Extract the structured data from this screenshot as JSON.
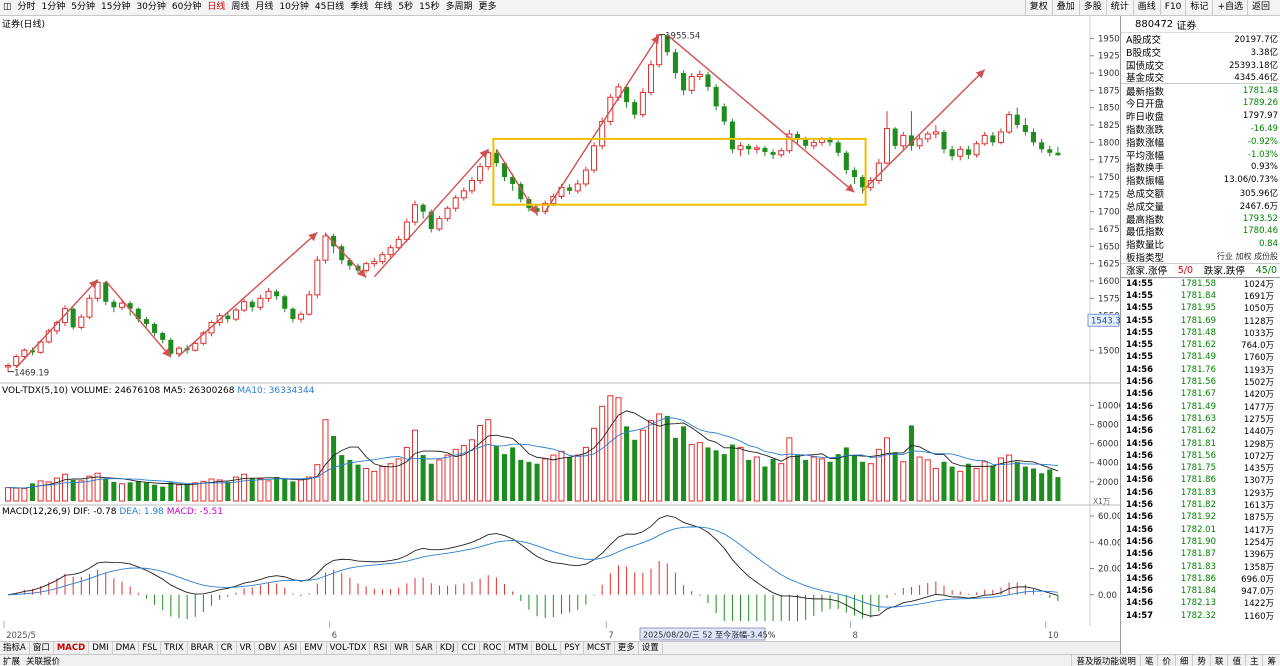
{
  "toolbar": {
    "periods": [
      "分时",
      "1分钟",
      "5分钟",
      "15分钟",
      "30分钟",
      "60分钟",
      "日线",
      "周线",
      "月线",
      "10分钟",
      "45日线",
      "季线",
      "年线",
      "5秒",
      "15秒",
      "多周期",
      "更多"
    ],
    "active_period": "日线",
    "right_tools": [
      "复权",
      "叠加",
      "多股",
      "统计",
      "画线",
      "F10",
      "标记",
      "+自选",
      "返回"
    ]
  },
  "price_pane": {
    "title": "证券(日线)",
    "y_ticks": [
      "1950",
      "1925",
      "1900",
      "1875",
      "1850",
      "1825",
      "1800",
      "1775",
      "1750",
      "1725",
      "1700",
      "1675",
      "1650",
      "1625",
      "1600",
      "1575",
      "1550",
      "1500"
    ],
    "high_label": "1955.54",
    "low_label": "1469.19",
    "current_marker": "1543.3"
  },
  "volume_pane": {
    "label": "VOL-TDX(5,10)",
    "volume": "VOLUME: 24676108",
    "ma5": "MA5: 26300268",
    "ma10": "MA10: 36334344",
    "y_ticks": [
      "10000",
      "8000",
      "6000",
      "4000",
      "2000"
    ],
    "unit": "X1万"
  },
  "macd_pane": {
    "label": "MACD(12,26,9)",
    "dif": "DIF: -0.78",
    "dea": "DEA: 1.98",
    "macd": "MACD: -5.51",
    "y_ticks": [
      "60.00",
      "40.00",
      "20.00",
      "0.00"
    ]
  },
  "x_axis": {
    "labels": [
      "2025/5",
      "6",
      "7",
      "8",
      "10"
    ],
    "cursor_date": "2025/08/20/三 52 至今涨幅-3.45%"
  },
  "indicator_tabs": [
    "指标A",
    "窗口",
    "MACD",
    "DMI",
    "DMA",
    "FSL",
    "TRIX",
    "BRAR",
    "CR",
    "VR",
    "OBV",
    "ASI",
    "EMV",
    "VOL-TDX",
    "RSI",
    "WR",
    "SAR",
    "KDJ",
    "CCI",
    "ROC",
    "MTM",
    "BOLL",
    "PSY",
    "MCST",
    "更多",
    "设置"
  ],
  "active_indicator": "MACD",
  "status": {
    "left": [
      "扩展",
      "关联报价"
    ],
    "right_link": "普及版功能说明",
    "right_tabs": [
      "笔",
      "价",
      "细",
      "势",
      "联",
      "值",
      "主",
      "筹"
    ]
  },
  "quote_panel": {
    "code": "880472",
    "name": "证券",
    "turnover": [
      {
        "label": "A股成交",
        "value": "20197.7亿"
      },
      {
        "label": "B股成交",
        "value": "3.38亿"
      },
      {
        "label": "国债成交",
        "value": "25393.18亿"
      },
      {
        "label": "基金成交",
        "value": "4345.46亿"
      }
    ],
    "stats": [
      {
        "label": "最新指数",
        "value": "1781.48",
        "color": "green"
      },
      {
        "label": "今日开盘",
        "value": "1789.26",
        "color": "green"
      },
      {
        "label": "昨日收盘",
        "value": "1797.97",
        "color": "black"
      },
      {
        "label": "指数涨跌",
        "value": "-16.49",
        "color": "green"
      },
      {
        "label": "指数涨幅",
        "value": "-0.92%",
        "color": "green"
      },
      {
        "label": "平均涨幅",
        "value": "-1.03%",
        "color": "green"
      },
      {
        "label": "指数换手",
        "value": "0.93%",
        "color": "black"
      },
      {
        "label": "指数振幅",
        "value": "13.06/0.73%",
        "color": "black"
      },
      {
        "label": "总成交额",
        "value": "305.96亿",
        "color": "black"
      },
      {
        "label": "总成交量",
        "value": "2467.6万",
        "color": "black"
      },
      {
        "label": "最高指数",
        "value": "1793.52",
        "color": "green"
      },
      {
        "label": "最低指数",
        "value": "1780.46",
        "color": "green"
      },
      {
        "label": "指数量比",
        "value": "0.84",
        "color": "green"
      }
    ],
    "board_type_label": "板指类型",
    "board_type_options": "行业 加权 成份股",
    "up_limit_label": "涨家.涨停",
    "up_limit_value": "5/0",
    "down_limit_label": "跌家.跌停",
    "down_limit_value": "45/0",
    "ticks": [
      {
        "time": "14:55",
        "price": "1781.58",
        "vol": "1024万"
      },
      {
        "time": "14:55",
        "price": "1781.84",
        "vol": "1691万"
      },
      {
        "time": "14:55",
        "price": "1781.95",
        "vol": "1050万"
      },
      {
        "time": "14:55",
        "price": "1781.69",
        "vol": "1128万"
      },
      {
        "time": "14:55",
        "price": "1781.48",
        "vol": "1033万"
      },
      {
        "time": "14:55",
        "price": "1781.62",
        "vol": "764.0万"
      },
      {
        "time": "14:55",
        "price": "1781.49",
        "vol": "1760万"
      },
      {
        "time": "14:56",
        "price": "1781.76",
        "vol": "1193万"
      },
      {
        "time": "14:56",
        "price": "1781.56",
        "vol": "1502万"
      },
      {
        "time": "14:56",
        "price": "1781.67",
        "vol": "1420万"
      },
      {
        "time": "14:56",
        "price": "1781.49",
        "vol": "1477万"
      },
      {
        "time": "14:56",
        "price": "1781.63",
        "vol": "1275万"
      },
      {
        "time": "14:56",
        "price": "1781.62",
        "vol": "1440万"
      },
      {
        "time": "14:56",
        "price": "1781.81",
        "vol": "1298万"
      },
      {
        "time": "14:56",
        "price": "1781.56",
        "vol": "1072万"
      },
      {
        "time": "14:56",
        "price": "1781.75",
        "vol": "1435万"
      },
      {
        "time": "14:56",
        "price": "1781.86",
        "vol": "1307万"
      },
      {
        "time": "14:56",
        "price": "1781.83",
        "vol": "1293万"
      },
      {
        "time": "14:56",
        "price": "1781.82",
        "vol": "1613万"
      },
      {
        "time": "14:56",
        "price": "1781.92",
        "vol": "1875万"
      },
      {
        "time": "14:56",
        "price": "1782.01",
        "vol": "1417万"
      },
      {
        "time": "14:56",
        "price": "1781.90",
        "vol": "1254万"
      },
      {
        "time": "14:56",
        "price": "1781.87",
        "vol": "1396万"
      },
      {
        "time": "14:56",
        "price": "1781.83",
        "vol": "1358万"
      },
      {
        "time": "14:56",
        "price": "1781.86",
        "vol": "696.0万"
      },
      {
        "time": "14:56",
        "price": "1781.84",
        "vol": "947.0万"
      },
      {
        "time": "14:56",
        "price": "1782.13",
        "vol": "1422万"
      },
      {
        "time": "14:57",
        "price": "1782.32",
        "vol": "1160万"
      }
    ]
  },
  "colors": {
    "up": "#e03030",
    "down": "#1e8c1e",
    "arrow": "#d05050",
    "box": "#f0c000",
    "dif_line": "#202020",
    "dea_line": "#2a7fd0"
  },
  "chart_data": {
    "type": "candlestick",
    "price_range": [
      1469.19,
      1955.54
    ],
    "candles": [
      [
        1476,
        1478,
        1469,
        1481
      ],
      [
        1478,
        1491,
        1475,
        1494
      ],
      [
        1491,
        1500,
        1488,
        1503
      ],
      [
        1500,
        1497,
        1493,
        1504
      ],
      [
        1497,
        1512,
        1495,
        1515
      ],
      [
        1512,
        1528,
        1510,
        1531
      ],
      [
        1528,
        1540,
        1523,
        1543
      ],
      [
        1540,
        1560,
        1535,
        1565
      ],
      [
        1560,
        1533,
        1530,
        1562
      ],
      [
        1533,
        1548,
        1530,
        1552
      ],
      [
        1548,
        1575,
        1545,
        1580
      ],
      [
        1575,
        1598,
        1570,
        1602
      ],
      [
        1598,
        1570,
        1565,
        1600
      ],
      [
        1570,
        1562,
        1555,
        1573
      ],
      [
        1562,
        1568,
        1558,
        1572
      ],
      [
        1568,
        1560,
        1550,
        1571
      ],
      [
        1560,
        1545,
        1540,
        1562
      ],
      [
        1545,
        1538,
        1533,
        1548
      ],
      [
        1538,
        1525,
        1520,
        1540
      ],
      [
        1525,
        1515,
        1510,
        1527
      ],
      [
        1515,
        1495,
        1492,
        1518
      ],
      [
        1495,
        1503,
        1490,
        1506
      ],
      [
        1503,
        1500,
        1495,
        1508
      ],
      [
        1500,
        1510,
        1498,
        1514
      ],
      [
        1510,
        1525,
        1507,
        1528
      ],
      [
        1525,
        1540,
        1520,
        1543
      ],
      [
        1540,
        1550,
        1535,
        1554
      ],
      [
        1550,
        1545,
        1540,
        1555
      ],
      [
        1545,
        1558,
        1542,
        1562
      ],
      [
        1558,
        1570,
        1555,
        1574
      ],
      [
        1570,
        1562,
        1556,
        1573
      ],
      [
        1562,
        1575,
        1558,
        1580
      ],
      [
        1575,
        1585,
        1570,
        1590
      ],
      [
        1585,
        1578,
        1573,
        1588
      ],
      [
        1578,
        1560,
        1555,
        1580
      ],
      [
        1560,
        1545,
        1540,
        1562
      ],
      [
        1545,
        1552,
        1540,
        1556
      ],
      [
        1552,
        1580,
        1550,
        1586
      ],
      [
        1580,
        1630,
        1575,
        1636
      ],
      [
        1630,
        1665,
        1625,
        1670
      ],
      [
        1665,
        1650,
        1640,
        1668
      ],
      [
        1650,
        1630,
        1624,
        1653
      ],
      [
        1630,
        1622,
        1616,
        1633
      ],
      [
        1622,
        1615,
        1610,
        1625
      ],
      [
        1615,
        1625,
        1612,
        1628
      ],
      [
        1625,
        1628,
        1620,
        1633
      ],
      [
        1628,
        1638,
        1624,
        1642
      ],
      [
        1638,
        1648,
        1634,
        1652
      ],
      [
        1648,
        1660,
        1644,
        1665
      ],
      [
        1660,
        1685,
        1656,
        1690
      ],
      [
        1685,
        1710,
        1680,
        1716
      ],
      [
        1710,
        1700,
        1690,
        1712
      ],
      [
        1700,
        1675,
        1670,
        1703
      ],
      [
        1675,
        1690,
        1672,
        1694
      ],
      [
        1690,
        1705,
        1686,
        1708
      ],
      [
        1705,
        1720,
        1700,
        1724
      ],
      [
        1720,
        1730,
        1716,
        1735
      ],
      [
        1730,
        1745,
        1726,
        1750
      ],
      [
        1745,
        1765,
        1740,
        1770
      ],
      [
        1765,
        1785,
        1760,
        1790
      ],
      [
        1785,
        1770,
        1765,
        1790
      ],
      [
        1770,
        1750,
        1744,
        1772
      ],
      [
        1750,
        1740,
        1730,
        1755
      ],
      [
        1740,
        1718,
        1713,
        1743
      ],
      [
        1718,
        1705,
        1700,
        1722
      ],
      [
        1705,
        1700,
        1694,
        1710
      ],
      [
        1700,
        1712,
        1696,
        1716
      ],
      [
        1712,
        1722,
        1708,
        1726
      ],
      [
        1722,
        1735,
        1718,
        1740
      ],
      [
        1735,
        1730,
        1725,
        1740
      ],
      [
        1730,
        1740,
        1726,
        1746
      ],
      [
        1740,
        1760,
        1736,
        1765
      ],
      [
        1760,
        1795,
        1756,
        1800
      ],
      [
        1795,
        1830,
        1790,
        1836
      ],
      [
        1830,
        1865,
        1825,
        1870
      ],
      [
        1865,
        1880,
        1860,
        1885
      ],
      [
        1880,
        1858,
        1850,
        1884
      ],
      [
        1858,
        1840,
        1834,
        1862
      ],
      [
        1840,
        1872,
        1836,
        1878
      ],
      [
        1872,
        1912,
        1868,
        1918
      ],
      [
        1912,
        1955,
        1908,
        1955.54
      ],
      [
        1955,
        1930,
        1925,
        1956
      ],
      [
        1930,
        1900,
        1892,
        1935
      ],
      [
        1900,
        1875,
        1868,
        1904
      ],
      [
        1875,
        1895,
        1870,
        1900
      ],
      [
        1895,
        1898,
        1890,
        1904
      ],
      [
        1898,
        1880,
        1874,
        1902
      ],
      [
        1880,
        1852,
        1846,
        1884
      ],
      [
        1852,
        1830,
        1825,
        1856
      ],
      [
        1830,
        1790,
        1784,
        1834
      ],
      [
        1790,
        1795,
        1780,
        1800
      ],
      [
        1795,
        1790,
        1782,
        1798
      ],
      [
        1790,
        1792,
        1784,
        1796
      ],
      [
        1792,
        1786,
        1780,
        1795
      ],
      [
        1786,
        1782,
        1776,
        1790
      ],
      [
        1782,
        1788,
        1778,
        1792
      ],
      [
        1788,
        1812,
        1784,
        1818
      ],
      [
        1812,
        1805,
        1798,
        1816
      ],
      [
        1805,
        1795,
        1790,
        1808
      ],
      [
        1795,
        1800,
        1790,
        1804
      ],
      [
        1800,
        1805,
        1795,
        1808
      ],
      [
        1805,
        1800,
        1795,
        1808
      ],
      [
        1800,
        1785,
        1780,
        1803
      ],
      [
        1785,
        1760,
        1754,
        1788
      ],
      [
        1760,
        1750,
        1740,
        1764
      ],
      [
        1750,
        1735,
        1726,
        1753
      ],
      [
        1735,
        1745,
        1730,
        1750
      ],
      [
        1745,
        1770,
        1740,
        1776
      ],
      [
        1770,
        1820,
        1768,
        1845
      ],
      [
        1820,
        1795,
        1790,
        1822
      ],
      [
        1795,
        1810,
        1790,
        1815
      ],
      [
        1810,
        1795,
        1788,
        1845
      ],
      [
        1795,
        1805,
        1790,
        1810
      ],
      [
        1805,
        1812,
        1800,
        1816
      ],
      [
        1812,
        1815,
        1806,
        1825
      ],
      [
        1815,
        1790,
        1784,
        1818
      ],
      [
        1790,
        1780,
        1774,
        1795
      ],
      [
        1780,
        1790,
        1774,
        1795
      ],
      [
        1790,
        1782,
        1776,
        1795
      ],
      [
        1782,
        1798,
        1778,
        1802
      ],
      [
        1798,
        1810,
        1795,
        1815
      ],
      [
        1810,
        1800,
        1795,
        1815
      ],
      [
        1800,
        1815,
        1797,
        1820
      ],
      [
        1815,
        1840,
        1812,
        1845
      ],
      [
        1840,
        1825,
        1820,
        1850
      ],
      [
        1825,
        1815,
        1810,
        1835
      ],
      [
        1815,
        1800,
        1795,
        1820
      ],
      [
        1800,
        1790,
        1785,
        1805
      ],
      [
        1790,
        1785,
        1780,
        1795
      ],
      [
        1785,
        1781.48,
        1780.46,
        1793.52
      ]
    ],
    "volume": [
      1400,
      1350,
      1300,
      1850,
      2100,
      2000,
      2400,
      2800,
      2200,
      2100,
      2600,
      2900,
      2350,
      2000,
      1800,
      1950,
      2100,
      1900,
      1700,
      1500,
      1950,
      1700,
      1750,
      1900,
      2050,
      2300,
      2200,
      2000,
      2500,
      2800,
      2400,
      2300,
      2100,
      2500,
      2300,
      2050,
      2200,
      2500,
      3800,
      8500,
      6800,
      4800,
      4300,
      3800,
      3400,
      3100,
      3600,
      3900,
      4400,
      5600,
      7400,
      4800,
      3900,
      4300,
      4800,
      5400,
      5800,
      6400,
      7900,
      8500,
      5800,
      4900,
      5600,
      4300,
      4100,
      3900,
      4400,
      4800,
      5200,
      4600,
      4800,
      5600,
      7600,
      9900,
      11000,
      10800,
      7800,
      6400,
      7400,
      8400,
      9100,
      8900,
      6600,
      7800,
      5900,
      6100,
      5600,
      5300,
      4900,
      5900,
      5600,
      4300,
      4600,
      3600,
      4400,
      3900,
      6600,
      4800,
      4300,
      4600,
      4400,
      4100,
      4900,
      5600,
      4800,
      4100,
      3900,
      5400,
      6600,
      5100,
      4100,
      7900,
      4600,
      4300,
      3400,
      4100,
      3600,
      3100,
      3900,
      3400,
      4100,
      3700,
      4500,
      4800,
      4100,
      3600,
      3400,
      2900,
      3300,
      2500
    ],
    "macd_ylim": [
      -20,
      60
    ],
    "x_labels": [
      "2025/5",
      "6",
      "7",
      "8",
      "10"
    ]
  }
}
